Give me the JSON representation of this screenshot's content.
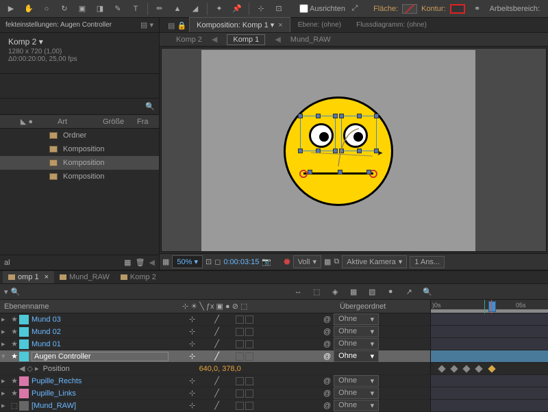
{
  "toolbar": {
    "align_label": "Ausrichten",
    "fill_label": "Fläche:",
    "stroke_label": "Kontur:",
    "workspace_label": "Arbeitsbereich:",
    "fill_color": "#773333",
    "stroke_color": "#cc2222"
  },
  "effect_panel": {
    "tab": "fekteinstellungen: Augen Controller",
    "title": "Komp 2 ▾",
    "resolution": "1280 x 720 (1,00)",
    "duration_fps": "Δ0:00:20:00, 25,00 fps"
  },
  "project": {
    "cols": {
      "type": "Art",
      "size": "Größe",
      "fr": "Fra"
    },
    "items": [
      {
        "name": "Ordner",
        "sel": false
      },
      {
        "name": "Komposition",
        "sel": false
      },
      {
        "name": "Komposition",
        "sel": true
      },
      {
        "name": "Komposition",
        "sel": false
      }
    ]
  },
  "comp_tabs": [
    {
      "label": "Komposition: Komp 1 ▾",
      "active": true,
      "closeable": true
    },
    {
      "label": "Ebene: (ohne)",
      "active": false
    },
    {
      "label": "Flussdiagramm: (ohne)",
      "active": false
    }
  ],
  "breadcrumb": [
    {
      "label": "Komp 2",
      "active": false
    },
    {
      "label": "Komp 1",
      "active": true
    },
    {
      "label": "Mund_RAW",
      "active": false
    }
  ],
  "comp_footer": {
    "zoom": "50%",
    "timecode": "0:00:03:15",
    "quality": "Voll",
    "camera": "Aktive Kamera",
    "views": "1 Ans..."
  },
  "timeline_tabs": [
    {
      "label": "omp 1",
      "active": true
    },
    {
      "label": "Mund_RAW",
      "active": false
    },
    {
      "label": "Komp 2",
      "active": false
    }
  ],
  "tl_header": {
    "name": "Ebenenname",
    "parent": "Übergeordnet"
  },
  "layers": [
    {
      "name": "Mund 03",
      "color": "teal"
    },
    {
      "name": "Mund 02",
      "color": "teal"
    },
    {
      "name": "Mund 01",
      "color": "teal"
    },
    {
      "name": "Augen Controller",
      "color": "teal",
      "selected": true
    },
    {
      "prop": "Position",
      "value": "640,0, 378,0"
    },
    {
      "name": "Pupille_Rechts",
      "color": "pink"
    },
    {
      "name": "Pupille_Links",
      "color": "pink"
    },
    {
      "name": "[Mund_RAW]",
      "color": "gray"
    }
  ],
  "parent_none": "Ohne",
  "time_labels": {
    "zero": ")0s",
    "five": "05s"
  },
  "footer_left": "al"
}
